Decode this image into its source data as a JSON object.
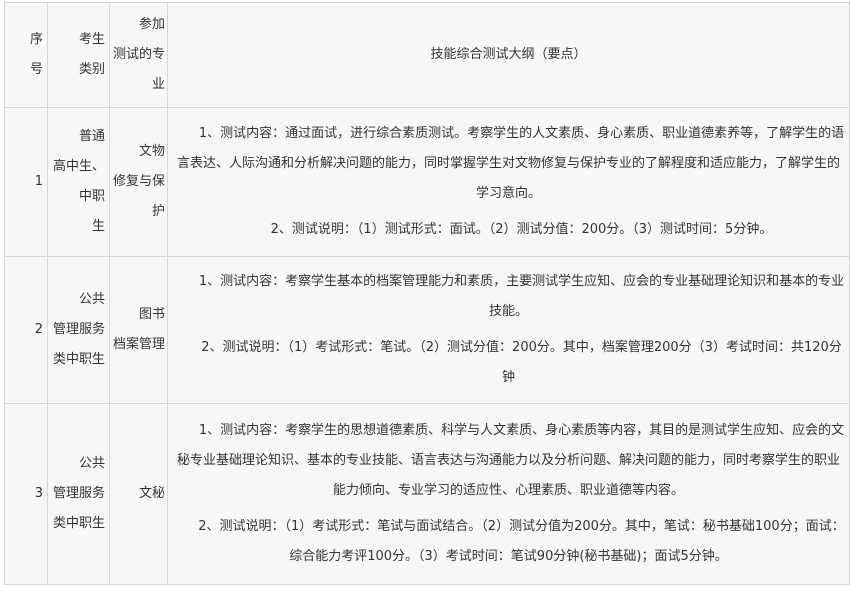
{
  "header": {
    "num": "序\n号",
    "category": "考生\n类别",
    "major": "参加\n测试的专\n业",
    "content": "技能综合测试大纲（要点）"
  },
  "rows": [
    {
      "num": "1",
      "category": "普通\n高中生、\n中职\n生",
      "major": "文物\n修复与保\n护",
      "content_1": "1、测试内容：通过面试，进行综合素质测试。考察学生的人文素质、身心素质、职业道德素养等，了解学生的语言表达、人际沟通和分析解决问题的能力，同时掌握学生对文物修复与保护专业的了解程度和适应能力，了解学生的学习意向。",
      "content_2": "2、测试说明：（1）测试形式：面试。（2）测试分值：200分。（3）测试时间：5分钟。"
    },
    {
      "num": "2",
      "category": "公共\n管理服务\n类中职生",
      "major": "图书\n档案管理",
      "content_1": "1、测试内容：考察学生基本的档案管理能力和素质，主要测试学生应知、应会的专业基础理论知识和基本的专业技能。",
      "content_2": "2、测试说明：（1）考试形式：笔试。（2）测试分值：200分。其中，档案管理200分（3）考试时间：共120分钟"
    },
    {
      "num": "3",
      "category": "公共\n管理服务\n类中职生",
      "major": "文秘",
      "content_1": "1、测试内容：考察学生的思想道德素质、科学与人文素质、身心素质等内容，其目的是测试学生应知、应会的文秘专业基础理论知识、基本的专业技能、语言表达与沟通能力以及分析问题、解决问题的能力，同时考察学生的职业能力倾向、专业学习的适应性、心理素质、职业道德等内容。",
      "content_2": "2、测试说明：（1）考试形式：笔试与面试结合。（2）测试分值为200分。其中，笔试：秘书基础100分；面试：综合能力考评100分。（3）考试时间：笔试90分钟(秘书基础)；面试5分钟。"
    }
  ]
}
